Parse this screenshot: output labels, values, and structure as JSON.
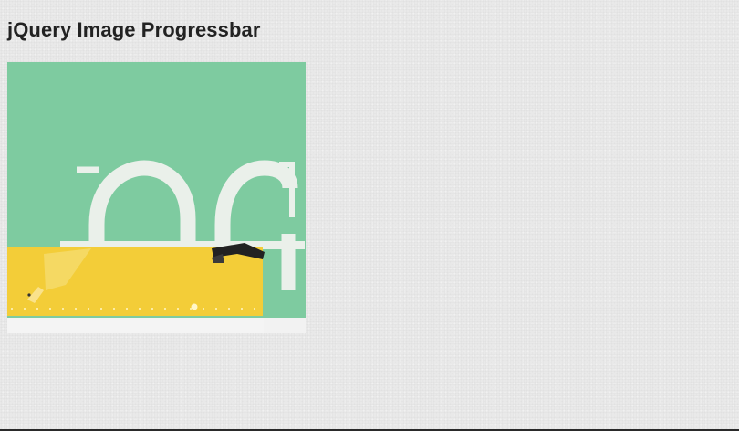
{
  "page": {
    "title": "jQuery Image Progressbar"
  },
  "progress": {
    "fraction": 0.86
  },
  "image": {
    "background_color": "#7ecba0",
    "letter_color": "#eaf0ea",
    "pencil_color": "#f3cd38",
    "track_color": "#f2f2f2"
  }
}
